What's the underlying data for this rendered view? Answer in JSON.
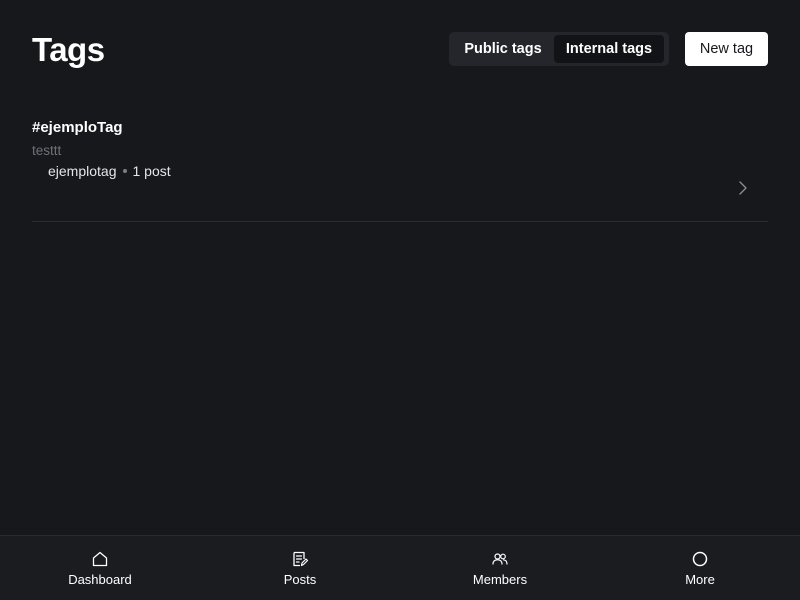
{
  "header": {
    "title": "Tags",
    "tabs": [
      {
        "label": "Public tags",
        "active": false
      },
      {
        "label": "Internal tags",
        "active": true
      }
    ],
    "new_tag_label": "New tag"
  },
  "tags": [
    {
      "name": "#ejemploTag",
      "description": "testtt",
      "slug": "ejemplotag",
      "count": "1 post"
    }
  ],
  "bottom_nav": {
    "items": [
      {
        "label": "Dashboard",
        "icon": "home-icon"
      },
      {
        "label": "Posts",
        "icon": "posts-icon"
      },
      {
        "label": "Members",
        "icon": "members-icon"
      },
      {
        "label": "More",
        "icon": "circle-icon"
      }
    ]
  },
  "colors": {
    "background": "#17181c",
    "button_bg": "#ffffff",
    "muted_text": "#6f7177"
  }
}
